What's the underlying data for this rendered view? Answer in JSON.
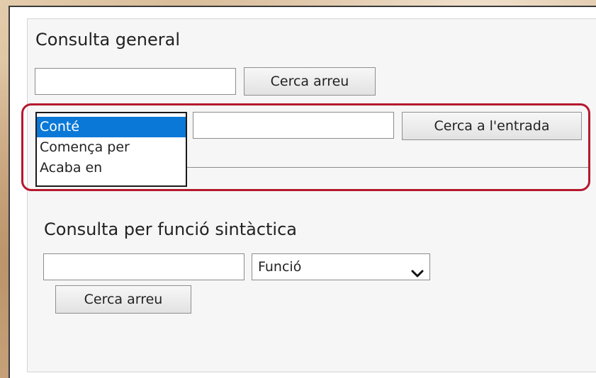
{
  "general_search": {
    "title": "Consulta general",
    "query_value": "",
    "search_everywhere_label": "Cerca arreu"
  },
  "entry_search": {
    "match_options": [
      "Conté",
      "Comença per",
      "Acaba en"
    ],
    "selected_option": "Conté",
    "query_value": "",
    "search_entry_label": "Cerca a l'entrada"
  },
  "syntactic_search": {
    "title": "Consulta per funció sintàctica",
    "query_value": "",
    "function_select": {
      "selected": "Funció",
      "icon": "chevron-down-icon"
    },
    "search_everywhere_label": "Cerca arreu"
  },
  "colors": {
    "highlight_outline": "#b5172e",
    "selected_option_bg": "#0a78d7"
  }
}
